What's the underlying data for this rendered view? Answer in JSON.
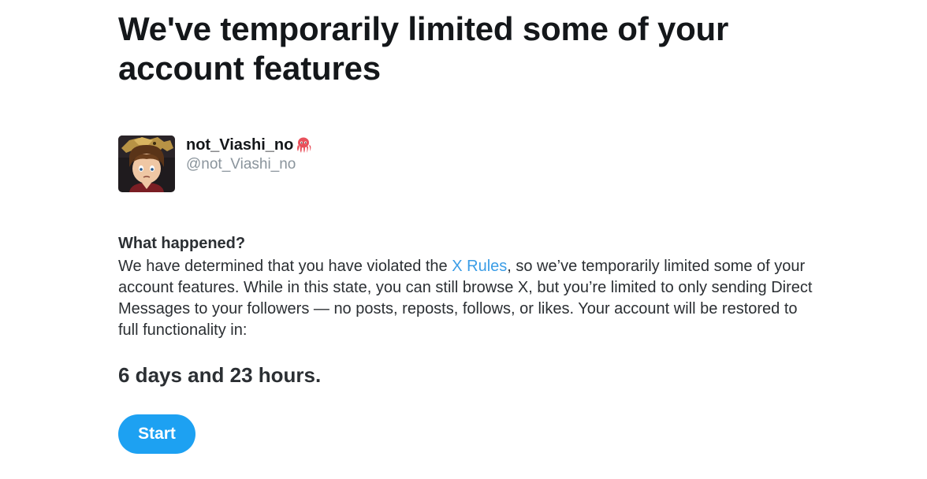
{
  "page": {
    "title": "We've temporarily limited some of your account features"
  },
  "profile": {
    "display_name": "not_Viashi_no",
    "name_emoji_icon": "octopus-icon",
    "handle": "@not_Viashi_no",
    "avatar_icon": "avatar-image"
  },
  "notice": {
    "heading": "What happened?",
    "body_before_link": "We have determined that you have violated the ",
    "link_text": "X Rules",
    "body_after_link": ", so we’ve temporarily limited some of your account features. While in this state, you can still browse X, but you’re limited to only sending Direct Messages to your followers — no posts, reposts, follows, or likes. Your account will be restored to full functionality in:",
    "countdown": "6 days and 23 hours."
  },
  "actions": {
    "start_label": "Start"
  },
  "colors": {
    "link": "#3b9de6",
    "button": "#1da1f2",
    "handle": "#8a949c",
    "text": "#2b2f33"
  }
}
